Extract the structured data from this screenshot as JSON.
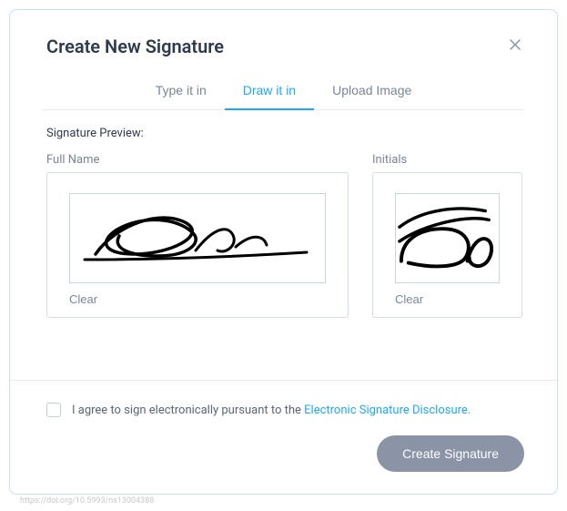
{
  "modal": {
    "title": "Create New Signature",
    "tabs": [
      {
        "label": "Type it in",
        "active": false
      },
      {
        "label": "Draw it in",
        "active": true
      },
      {
        "label": "Upload Image",
        "active": false
      }
    ],
    "preview_label": "Signature Preview:",
    "full_name": {
      "label": "Full Name",
      "clear": "Clear"
    },
    "initials": {
      "label": "Initials",
      "clear": "Clear"
    },
    "agree": {
      "checked": false,
      "text_prefix": "I agree to sign electronically pursuant to the ",
      "link_text": "Electronic Signature Disclosure."
    },
    "create_button": "Create Signature"
  },
  "watermark": "https://doi.org/10.5993/ns13004388"
}
